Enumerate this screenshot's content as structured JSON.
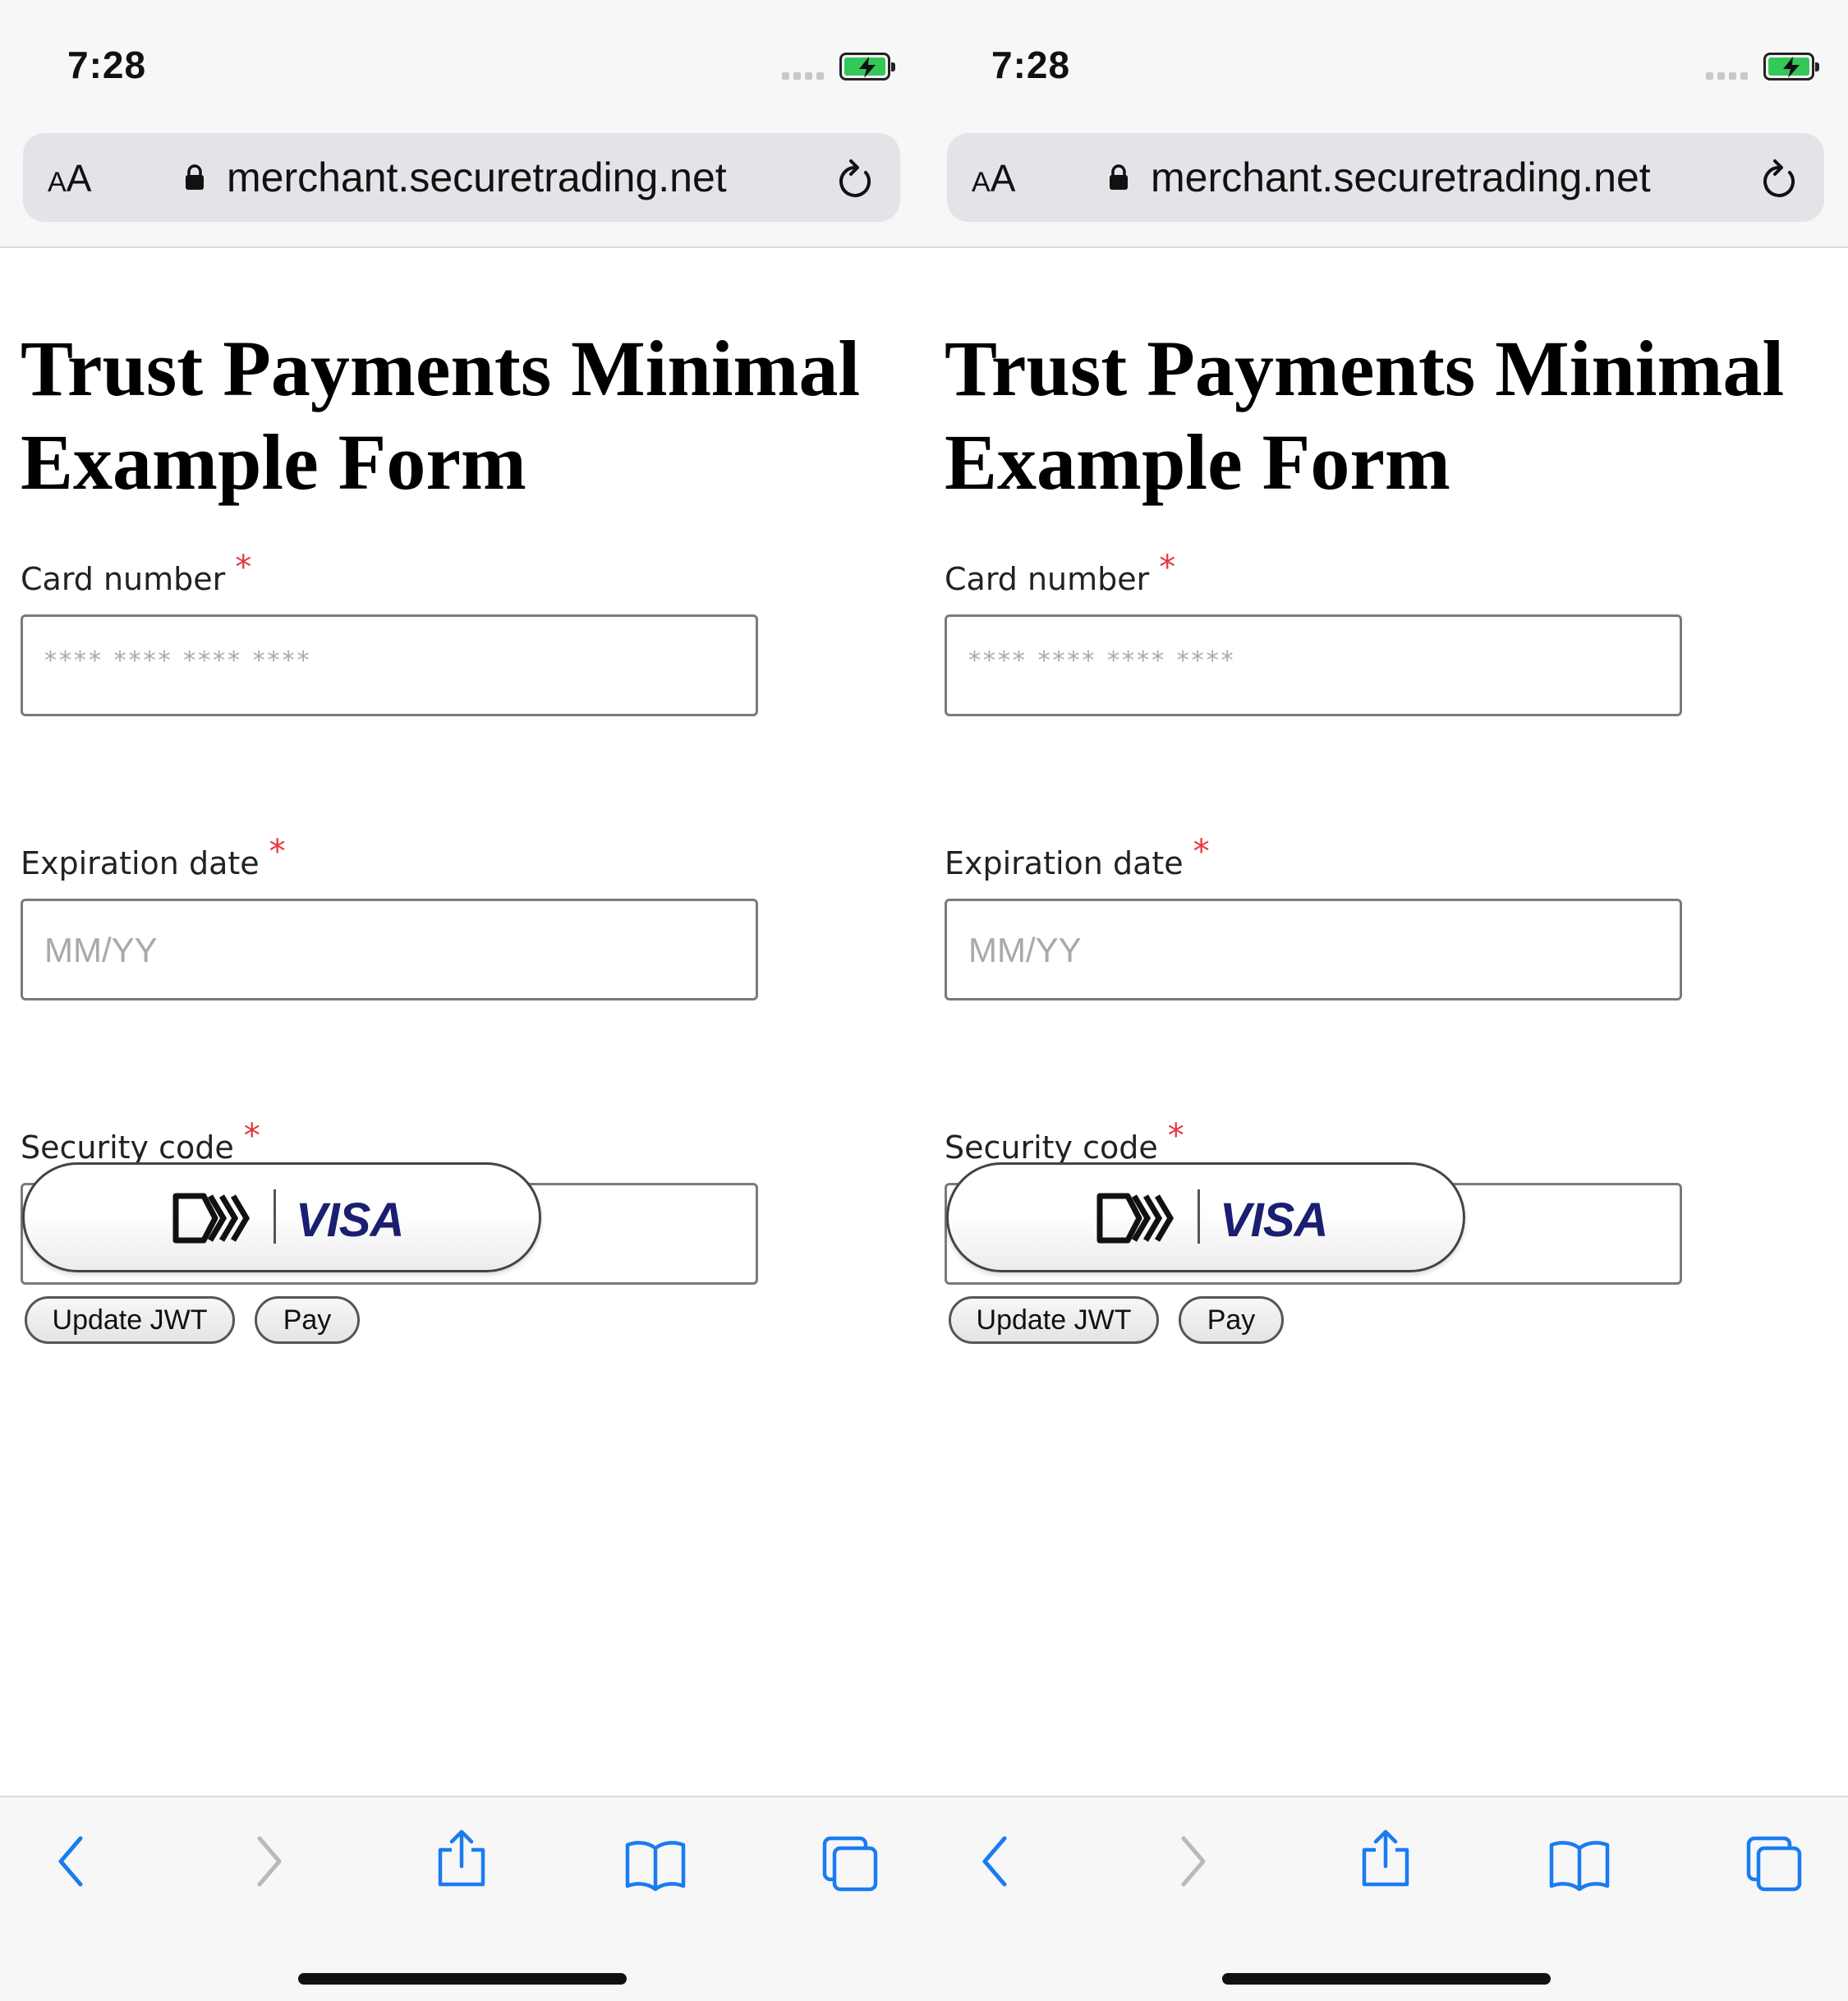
{
  "screens": [
    {
      "status": {
        "time": "7:28"
      },
      "browser": {
        "aa_small": "A",
        "aa_large": "A",
        "url": "merchant.securetrading.net"
      },
      "page": {
        "title": "Trust Payments Minimal Example Form",
        "fields": [
          {
            "label": "Card number",
            "required_mark": "*",
            "placeholder": "**** **** **** ****"
          },
          {
            "label": "Expiration date",
            "required_mark": "*",
            "placeholder": "MM/YY"
          },
          {
            "label": "Security code",
            "required_mark": "*",
            "placeholder": "***"
          }
        ],
        "visa_button": {
          "brand": "VISA"
        },
        "buttons": {
          "update_jwt": "Update JWT",
          "pay": "Pay"
        }
      }
    },
    {
      "status": {
        "time": "7:28"
      },
      "browser": {
        "aa_small": "A",
        "aa_large": "A",
        "url": "merchant.securetrading.net"
      },
      "page": {
        "title": "Trust Payments Minimal Example Form",
        "fields": [
          {
            "label": "Card number",
            "required_mark": "*",
            "placeholder": "**** **** **** ****"
          },
          {
            "label": "Expiration date",
            "required_mark": "*",
            "placeholder": "MM/YY"
          },
          {
            "label": "Security code",
            "required_mark": "*",
            "placeholder": "***"
          }
        ],
        "visa_button": {
          "brand": "VISA"
        },
        "buttons": {
          "update_jwt": "Update JWT",
          "pay": "Pay"
        }
      }
    }
  ],
  "icons": {
    "signal": "cellular-signal-icon",
    "battery": "battery-charging-icon",
    "lock": "lock-icon",
    "reload": "reload-icon",
    "back": "chevron-left-icon",
    "forward": "chevron-right-icon",
    "share": "share-icon",
    "bookmarks": "book-icon",
    "tabs": "tabs-icon",
    "click_to_pay": "click-to-pay-icon"
  },
  "colors": {
    "required": "#e5363c",
    "battery": "#34c759",
    "safari_blue": "#1a7cf0",
    "visa_blue": "#1a1f71"
  }
}
